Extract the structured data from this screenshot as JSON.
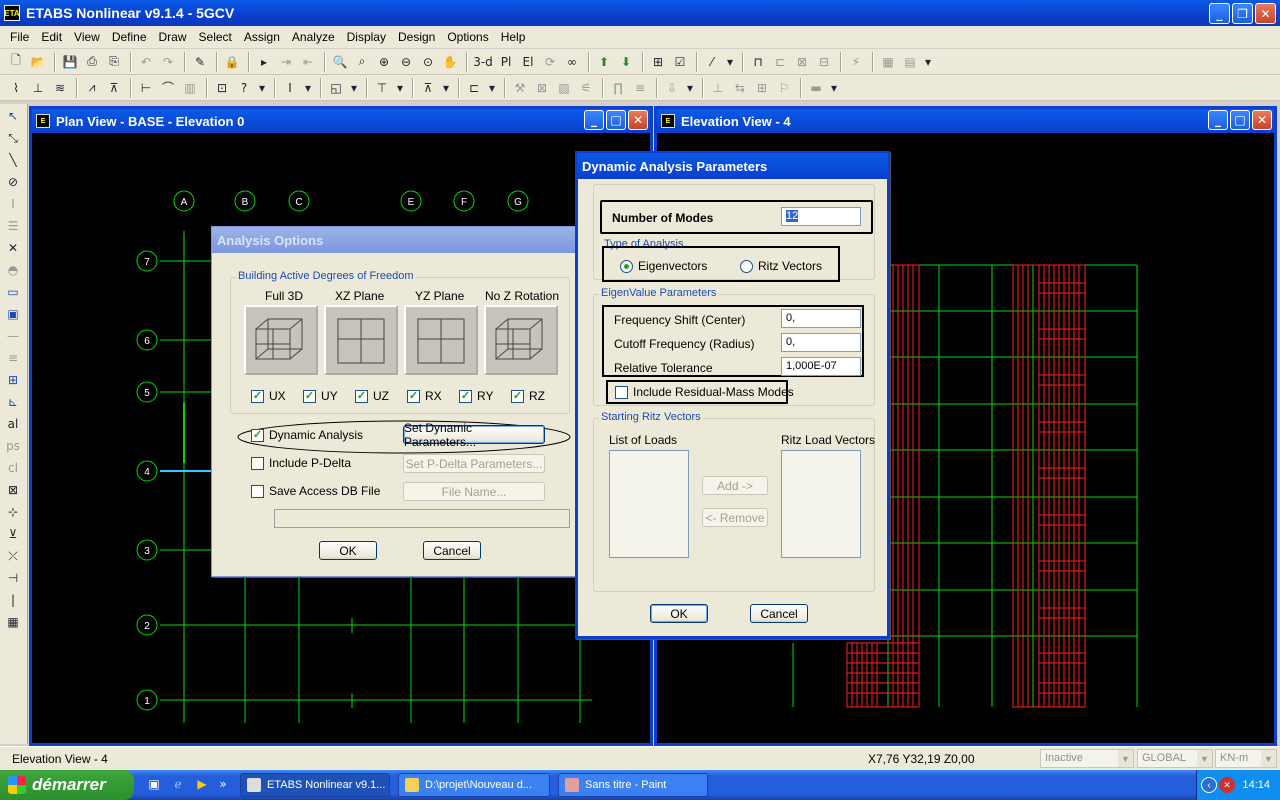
{
  "app": {
    "title": "ETABS Nonlinear v9.1.4 - 5GCV",
    "icon_text": "ETA"
  },
  "menu": [
    "File",
    "Edit",
    "View",
    "Define",
    "Draw",
    "Select",
    "Assign",
    "Analyze",
    "Display",
    "Design",
    "Options",
    "Help"
  ],
  "toolbar": {
    "view_3d": "3-d",
    "plan": "Pl",
    "elev": "El"
  },
  "plan_window": {
    "title": "Plan View - BASE - Elevation 0",
    "col_labels": [
      "A",
      "B",
      "C",
      "E",
      "F",
      "G"
    ],
    "row_labels": [
      "7",
      "6",
      "5",
      "4",
      "3",
      "2",
      "1"
    ]
  },
  "elev_window": {
    "title": "Elevation View - 4"
  },
  "analysis_options": {
    "title": "Analysis Options",
    "dof_group_label": "Building Active Degrees of Freedom",
    "dof_presets": [
      "Full 3D",
      "XZ Plane",
      "YZ Plane",
      "No Z Rotation"
    ],
    "dof_checks": [
      {
        "label": "UX",
        "checked": true
      },
      {
        "label": "UY",
        "checked": true
      },
      {
        "label": "UZ",
        "checked": true
      },
      {
        "label": "RX",
        "checked": true
      },
      {
        "label": "RY",
        "checked": true
      },
      {
        "label": "RZ",
        "checked": true
      }
    ],
    "dynamic_analysis": {
      "label": "Dynamic Analysis",
      "checked": true
    },
    "set_dynamic_button": "Set Dynamic Parameters...",
    "p_delta": {
      "label": "Include P-Delta",
      "checked": false
    },
    "set_pdelta_button": "Set P-Delta Parameters...",
    "save_access": {
      "label": "Save Access DB File",
      "checked": false
    },
    "file_name_button": "File Name...",
    "ok": "OK",
    "cancel": "Cancel"
  },
  "dynamic_params": {
    "title": "Dynamic Analysis Parameters",
    "num_modes_label": "Number of Modes",
    "num_modes_value": "12",
    "type_group_label": "Type of Analysis",
    "type_options": [
      {
        "label": "Eigenvectors",
        "selected": true
      },
      {
        "label": "Ritz Vectors",
        "selected": false
      }
    ],
    "eigen_group_label": "EigenValue Parameters",
    "freq_shift_label": "Frequency Shift  (Center)",
    "freq_shift_value": "0,",
    "cutoff_label": "Cutoff Frequency  (Radius)",
    "cutoff_value": "0,",
    "tolerance_label": "Relative Tolerance",
    "tolerance_value": "1,000E-07",
    "residual_mass": {
      "label": "Include Residual-Mass Modes",
      "checked": false
    },
    "ritz_group_label": "Starting Ritz Vectors",
    "list_of_loads_label": "List of Loads",
    "ritz_load_vectors_label": "Ritz Load Vectors",
    "add_button": "Add ->",
    "remove_button": "<- Remove",
    "ok": "OK",
    "cancel": "Cancel"
  },
  "status": {
    "left": "Elevation View - 4",
    "coords": "X7,76  Y32,19  Z0,00",
    "mode": "Inactive",
    "coord_system": "GLOBAL",
    "units": "KN-m"
  },
  "taskbar": {
    "start": "démarrer",
    "tasks": [
      "ETABS Nonlinear v9.1...",
      "D:\\projet\\Nouveau d...",
      "Sans titre - Paint"
    ],
    "clock": "14:14"
  },
  "colors": {
    "title_blue": "#0b3fcc",
    "grid_green": "#00ff00",
    "frame_red": "#ff0000",
    "dialog_bg": "#ece9d8",
    "check_green": "#21a121"
  }
}
